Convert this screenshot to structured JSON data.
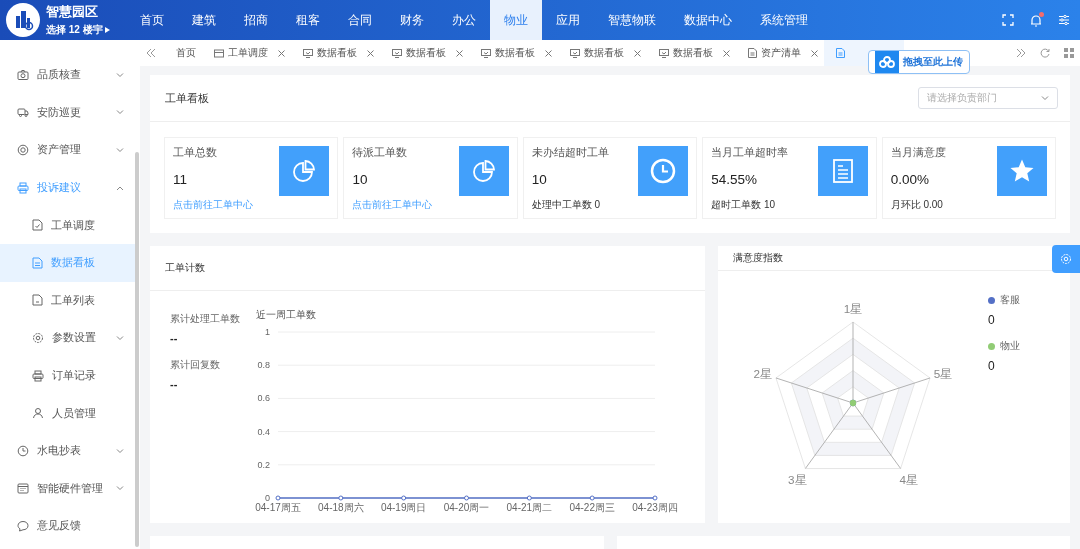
{
  "header": {
    "app_title": "智慧园区",
    "building_selector": "选择 12 楼宇",
    "notification_dot": true,
    "nav": [
      {
        "label": "首页",
        "selected": false
      },
      {
        "label": "建筑",
        "selected": false
      },
      {
        "label": "招商",
        "selected": false
      },
      {
        "label": "租客",
        "selected": false
      },
      {
        "label": "合同",
        "selected": false
      },
      {
        "label": "财务",
        "selected": false
      },
      {
        "label": "办公",
        "selected": false
      },
      {
        "label": "物业",
        "selected": true
      },
      {
        "label": "应用",
        "selected": false
      },
      {
        "label": "智慧物联",
        "selected": false
      },
      {
        "label": "数据中心",
        "selected": false
      },
      {
        "label": "系统管理",
        "selected": false
      }
    ]
  },
  "sidebar": {
    "items": [
      {
        "label": "品质核查",
        "kind": "group",
        "expanded": false,
        "selected": false
      },
      {
        "label": "安防巡更",
        "kind": "group",
        "expanded": false,
        "selected": false
      },
      {
        "label": "资产管理",
        "kind": "group",
        "expanded": false,
        "selected": false
      },
      {
        "label": "投诉建议",
        "kind": "group",
        "expanded": true,
        "selected": false,
        "children": [
          {
            "label": "工单调度",
            "kind": "link",
            "selected": false
          },
          {
            "label": "数据看板",
            "kind": "link",
            "selected": true
          },
          {
            "label": "工单列表",
            "kind": "link",
            "selected": false
          },
          {
            "label": "参数设置",
            "kind": "group",
            "expanded": false,
            "selected": false
          },
          {
            "label": "订单记录",
            "kind": "link",
            "selected": false
          },
          {
            "label": "人员管理",
            "kind": "link",
            "selected": false
          }
        ]
      },
      {
        "label": "水电抄表",
        "kind": "group",
        "expanded": false,
        "selected": false
      },
      {
        "label": "智能硬件管理",
        "kind": "group",
        "expanded": false,
        "selected": false
      },
      {
        "label": "意见反馈",
        "kind": "link",
        "selected": false
      }
    ]
  },
  "tabs": [
    {
      "label": "首页",
      "selected": false,
      "closable": false
    },
    {
      "label": "工单调度",
      "selected": false,
      "closable": true
    },
    {
      "label": "数据看板",
      "selected": false,
      "closable": true
    },
    {
      "label": "数据看板",
      "selected": false,
      "closable": true
    },
    {
      "label": "数据看板",
      "selected": false,
      "closable": true
    },
    {
      "label": "数据看板",
      "selected": false,
      "closable": true
    },
    {
      "label": "数据看板",
      "selected": false,
      "closable": true
    },
    {
      "label": "资产清单",
      "selected": false,
      "closable": true
    },
    {
      "selected": true,
      "closable": false
    }
  ],
  "upload_hint": "拖拽至此上传",
  "dashboard": {
    "title": "工单看板",
    "department_select": {
      "placeholder": "请选择负责部门"
    },
    "stats": [
      {
        "title": "工单总数",
        "value": "11",
        "footer": "点击前往工单中心",
        "kind": "link"
      },
      {
        "title": "待派工单数",
        "value": "10",
        "footer": "点击前往工单中心",
        "kind": "link"
      },
      {
        "title": "未办结超时工单",
        "value": "10",
        "footer": "处理中工单数 0",
        "kind": "text"
      },
      {
        "title": "当月工单超时率",
        "value": "54.55%",
        "footer": "超时工单数 10",
        "kind": "text"
      },
      {
        "title": "当月满意度",
        "value": "0.00%",
        "footer": "月环比 0.00",
        "kind": "text"
      }
    ]
  },
  "order_count": {
    "title": "工单计数",
    "totals": [
      {
        "label": "累计处理工单数",
        "value": "--"
      },
      {
        "label": "累计回复数",
        "value": "--"
      }
    ],
    "chart_data": {
      "type": "line",
      "ylabel": "近一周工单数",
      "categories": [
        "04-17周五",
        "04-18周六",
        "04-19周日",
        "04-20周一",
        "04-21周二",
        "04-22周三",
        "04-23周四"
      ],
      "series": [
        {
          "color": "#5470c6",
          "marker": true,
          "values": [
            0,
            0,
            0,
            0,
            0,
            0,
            0
          ]
        }
      ],
      "grid": true,
      "ylim": [
        0,
        1
      ],
      "yticks": [
        0,
        0.2,
        0.4,
        0.6,
        0.8,
        1
      ]
    }
  },
  "satisfaction": {
    "title": "满意度指数",
    "axes": [
      "1星",
      "5星",
      "4星",
      "3星",
      "2星"
    ],
    "legend": [
      {
        "name": "客服",
        "color": "#5470c6",
        "value": "0"
      },
      {
        "name": "物业",
        "color": "#91cc75",
        "value": "0"
      }
    ]
  }
}
